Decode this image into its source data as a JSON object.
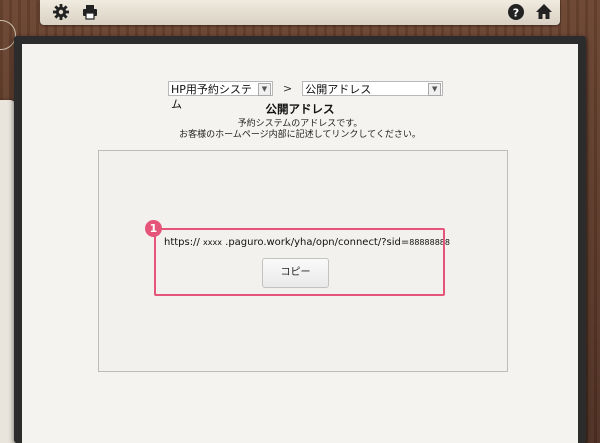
{
  "toolbar": {
    "left_icons": [
      "gear-icon",
      "printer-icon"
    ],
    "right_icons": [
      "help-icon",
      "home-icon"
    ]
  },
  "breadcrumb": {
    "system_select": "HP用予約システム",
    "separator": ">",
    "page_select": "公開アドレス"
  },
  "page": {
    "title": "公開アドレス",
    "description_line1": "予約システムのアドレスです。",
    "description_line2": "お客様のホームページ内部に記述してリンクしてください。"
  },
  "address": {
    "prefix": "https:// ",
    "host_mask": "xxxx",
    "path": " .paguro.work/yha/opn/connect/?sid=",
    "sid_mask": "88888888"
  },
  "copy_button_label": "コピー",
  "annotation": {
    "marker_number": "1",
    "color": "#e5557a"
  }
}
